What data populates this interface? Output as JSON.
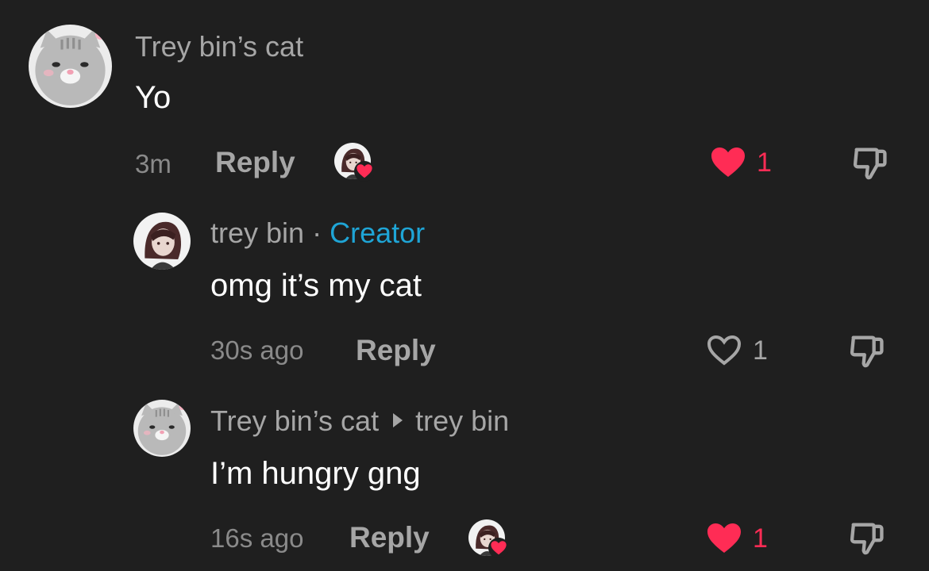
{
  "colors": {
    "background": "#1f1f1f",
    "like_active": "#ff2c55",
    "creator_badge": "#1fa5d6",
    "muted_text": "#a6a6a6"
  },
  "comments": [
    {
      "author": "Trey bin’s cat",
      "text": "Yo",
      "time": "3m",
      "reply_label": "Reply",
      "likes": "1",
      "liked": true,
      "creator_liked": true,
      "avatar_icon": "cat-avatar-icon"
    },
    {
      "author": "trey bin",
      "separator": "·",
      "badge": "Creator",
      "text": "omg it’s my cat",
      "time": "30s ago",
      "reply_label": "Reply",
      "likes": "1",
      "liked": false,
      "avatar_icon": "creator-avatar-icon"
    },
    {
      "author": "Trey bin’s cat",
      "reply_to": "trey bin",
      "text": "I’m hungry gng",
      "time": "16s ago",
      "reply_label": "Reply",
      "likes": "1",
      "liked": true,
      "creator_liked": true,
      "avatar_icon": "cat-avatar-icon"
    }
  ]
}
